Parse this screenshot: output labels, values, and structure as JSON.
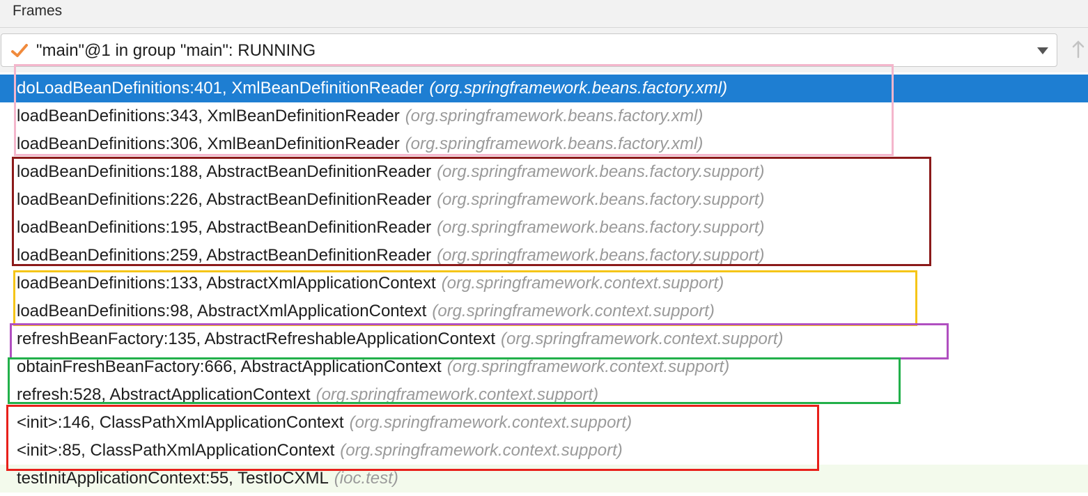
{
  "panel": {
    "title": "Frames"
  },
  "thread_selector": {
    "value": "\"main\"@1 in group \"main\": RUNNING",
    "status_icon": "check-icon",
    "status_color": "#f08a3c"
  },
  "frames": [
    {
      "method": "doLoadBeanDefinitions:401, XmlBeanDefinitionReader",
      "package": "(org.springframework.beans.factory.xml)"
    },
    {
      "method": "loadBeanDefinitions:343, XmlBeanDefinitionReader",
      "package": "(org.springframework.beans.factory.xml)"
    },
    {
      "method": "loadBeanDefinitions:306, XmlBeanDefinitionReader",
      "package": "(org.springframework.beans.factory.xml)"
    },
    {
      "method": "loadBeanDefinitions:188, AbstractBeanDefinitionReader",
      "package": "(org.springframework.beans.factory.support)"
    },
    {
      "method": "loadBeanDefinitions:226, AbstractBeanDefinitionReader",
      "package": "(org.springframework.beans.factory.support)"
    },
    {
      "method": "loadBeanDefinitions:195, AbstractBeanDefinitionReader",
      "package": "(org.springframework.beans.factory.support)"
    },
    {
      "method": "loadBeanDefinitions:259, AbstractBeanDefinitionReader",
      "package": "(org.springframework.beans.factory.support)"
    },
    {
      "method": "loadBeanDefinitions:133, AbstractXmlApplicationContext",
      "package": "(org.springframework.context.support)"
    },
    {
      "method": "loadBeanDefinitions:98, AbstractXmlApplicationContext",
      "package": "(org.springframework.context.support)"
    },
    {
      "method": "refreshBeanFactory:135, AbstractRefreshableApplicationContext",
      "package": "(org.springframework.context.support)"
    },
    {
      "method": "obtainFreshBeanFactory:666, AbstractApplicationContext",
      "package": "(org.springframework.context.support)"
    },
    {
      "method": "refresh:528, AbstractApplicationContext",
      "package": "(org.springframework.context.support)"
    },
    {
      "method": "<init>:146, ClassPathXmlApplicationContext",
      "package": "(org.springframework.context.support)"
    },
    {
      "method": "<init>:85, ClassPathXmlApplicationContext",
      "package": "(org.springframework.context.support)"
    },
    {
      "method": "testInitApplicationContext:55, TestIoCXML",
      "package": "(ioc.test)"
    }
  ],
  "colors": {
    "selected_row": "#1e7ed2",
    "user_code_row": "#f3faec",
    "box_pink": "#f4b6cc",
    "box_darkred": "#8b1a1a",
    "box_yellow": "#f5c518",
    "box_purple": "#b04fc0",
    "box_green": "#22b04a",
    "box_red": "#e8201a"
  }
}
